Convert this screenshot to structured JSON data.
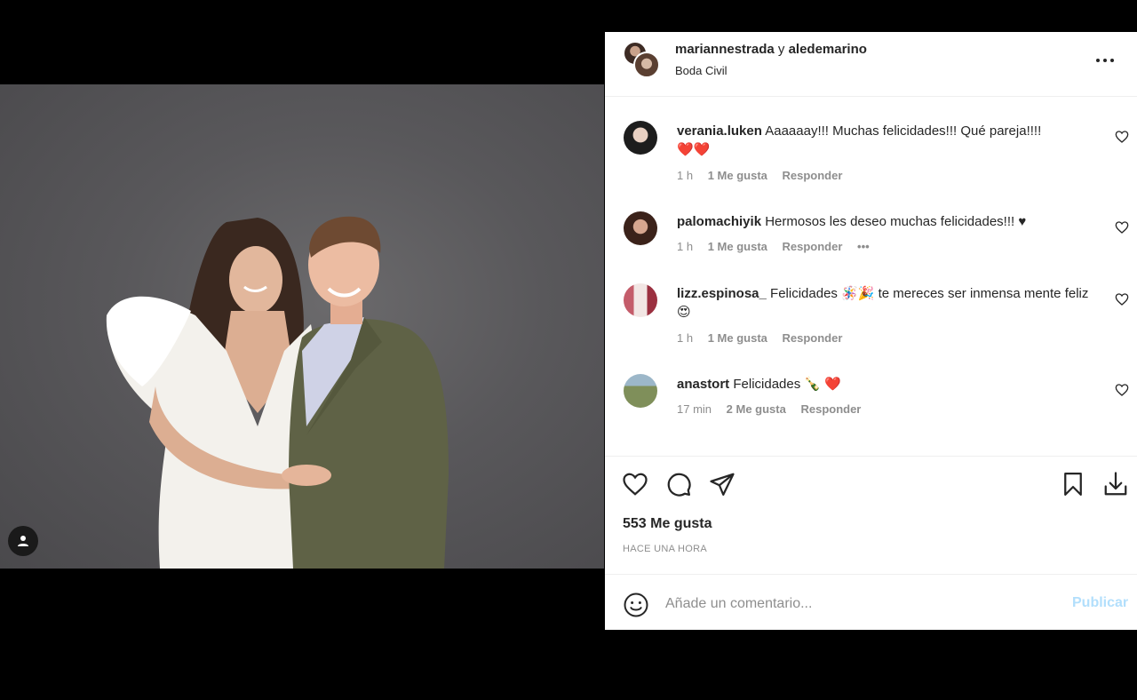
{
  "post": {
    "author1": "mariannestrada",
    "conjunction": "y",
    "author2": "aledemarino",
    "location": "Boda Civil",
    "likes": "553 Me gusta",
    "time": "HACE UNA HORA"
  },
  "comments": [
    {
      "user": "verania.luken",
      "text": "Aaaaaay!!! Muchas felicidades!!! Qué pareja!!!!",
      "emoji": "❤️❤️",
      "time": "1 h",
      "likes": "1 Me gusta",
      "reply": "Responder"
    },
    {
      "user": "palomachiyik",
      "text": "Hermosos les deseo muchas felicidades!!! ♥",
      "time": "1 h",
      "likes": "1 Me gusta",
      "reply": "Responder",
      "more": "•••"
    },
    {
      "user": "lizz.espinosa_",
      "text": "Felicidades 🪅🎉 te mereces ser inmensa mente feliz 😍",
      "time": "1 h",
      "likes": "1 Me gusta",
      "reply": "Responder"
    },
    {
      "user": "anastort",
      "text": "Felicidades 🍾 ❤️",
      "time": "17 min",
      "likes": "2 Me gusta",
      "reply": "Responder"
    }
  ],
  "add_comment": {
    "placeholder": "Añade un comentario...",
    "publish": "Publicar"
  },
  "icons": {
    "like": "heart-icon",
    "comment": "comment-icon",
    "share": "send-icon",
    "save": "bookmark-icon",
    "download": "download-icon",
    "emoji": "emoji-icon",
    "more": "more-options-icon",
    "user_tag": "user-icon"
  },
  "colors": {
    "publish_disabled": "#b2dffc",
    "meta": "#8e8e8e",
    "heart": "#ed4956"
  }
}
